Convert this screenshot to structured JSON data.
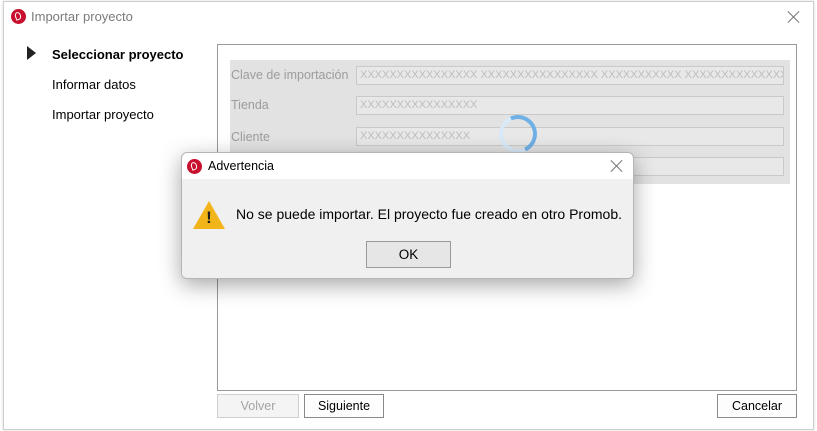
{
  "window": {
    "title": "Importar proyecto",
    "close_icon": "close-icon"
  },
  "steps": [
    {
      "label": "Seleccionar proyecto",
      "active": true
    },
    {
      "label": "Informar datos",
      "active": false
    },
    {
      "label": "Importar proyecto",
      "active": false
    }
  ],
  "form": {
    "fields": [
      {
        "label": "Clave de importación",
        "value": "XXXXXXXXXXXXXXXX XXXXXXXXXXXXXXXX XXXXXXXXXXX XXXXXXXXXXXXXXXX"
      },
      {
        "label": "Tienda",
        "value": "XXXXXXXXXXXXXXXX"
      },
      {
        "label": "Cliente",
        "value": "XXXXXXXXXXXXXXX"
      },
      {
        "label": "",
        "value": ""
      }
    ]
  },
  "buttons": {
    "back": "Volver",
    "next": "Siguiente",
    "cancel": "Cancelar"
  },
  "dialog": {
    "title": "Advertencia",
    "message": "No se puede importar. El proyecto fue creado en otro Promob.",
    "ok": "OK",
    "warn_mark": "!"
  },
  "colors": {
    "brand": "#c8102e",
    "warning": "#f1b419",
    "spinner": "#6fb0e6"
  }
}
